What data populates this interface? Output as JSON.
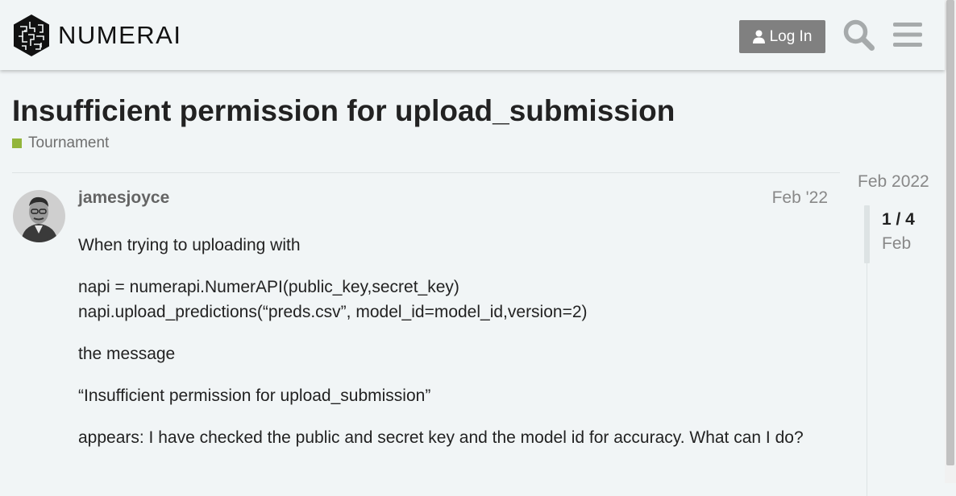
{
  "header": {
    "logo_text": "NUMERAI",
    "login_label": "Log In",
    "icons": [
      "user-icon",
      "search-icon",
      "hamburger-menu-icon"
    ]
  },
  "topic": {
    "title": "Insufficient permission for upload_submission",
    "category": "Tournament",
    "category_color": "#92b53b"
  },
  "post": {
    "username": "jamesjoyce",
    "date": "Feb '22",
    "paragraphs": [
      "When trying to uploading with",
      "napi = numerapi.NumerAPI(public_key,secret_key)",
      "napi.upload_predictions(“preds.csv”, model_id=model_id,version=2)",
      "the message",
      "“Insufficient permission for upload_submission”",
      "appears: I have checked the public and secret key and the model id for accuracy. What can I do?"
    ]
  },
  "timeline": {
    "start_date": "Feb 2022",
    "position": "1 / 4",
    "current_date": "Feb"
  },
  "colors": {
    "background": "#f1f5f6",
    "button": "#808080",
    "muted_text": "#888888"
  }
}
